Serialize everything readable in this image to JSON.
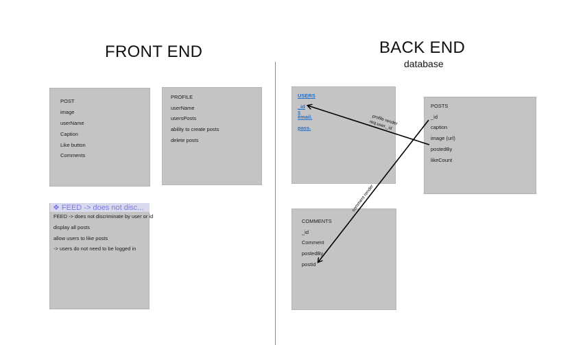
{
  "headings": {
    "front_end": "FRONT END",
    "back_end": "BACK END",
    "back_end_sub": "database"
  },
  "post_card": [
    "POST",
    "image",
    "userName",
    "Caption",
    "Like button",
    "Comments"
  ],
  "profile_card": [
    "PROFILE",
    "userName",
    "usersPosts",
    "ability to create posts",
    "delete posts"
  ],
  "feed": {
    "heading": "❖ FEED -> does not disc...",
    "lines": [
      "FEED -> does not discriminate by user or id",
      "display all posts",
      "allow users to like posts",
      "-> users do not need to be logged in"
    ]
  },
  "users_card": [
    "USERS",
    "_id",
    "s",
    "email.",
    "pass."
  ],
  "posts_card": [
    "POSTS",
    "_id",
    "caption",
    "image (url)",
    "postedBy",
    "likeCount"
  ],
  "comments_card": [
    "COMMENTS",
    "_id",
    "Comment",
    "postedBy",
    "postId"
  ],
  "arrows": {
    "profile_render_line1": "profile render",
    "profile_render_line2": "req.user._id",
    "comment_render": "comment render"
  },
  "colors": {
    "card_fill": "#c4c4c4",
    "link_blue": "#1f6fd1",
    "feed_heading_purple": "#7c7ae6"
  }
}
